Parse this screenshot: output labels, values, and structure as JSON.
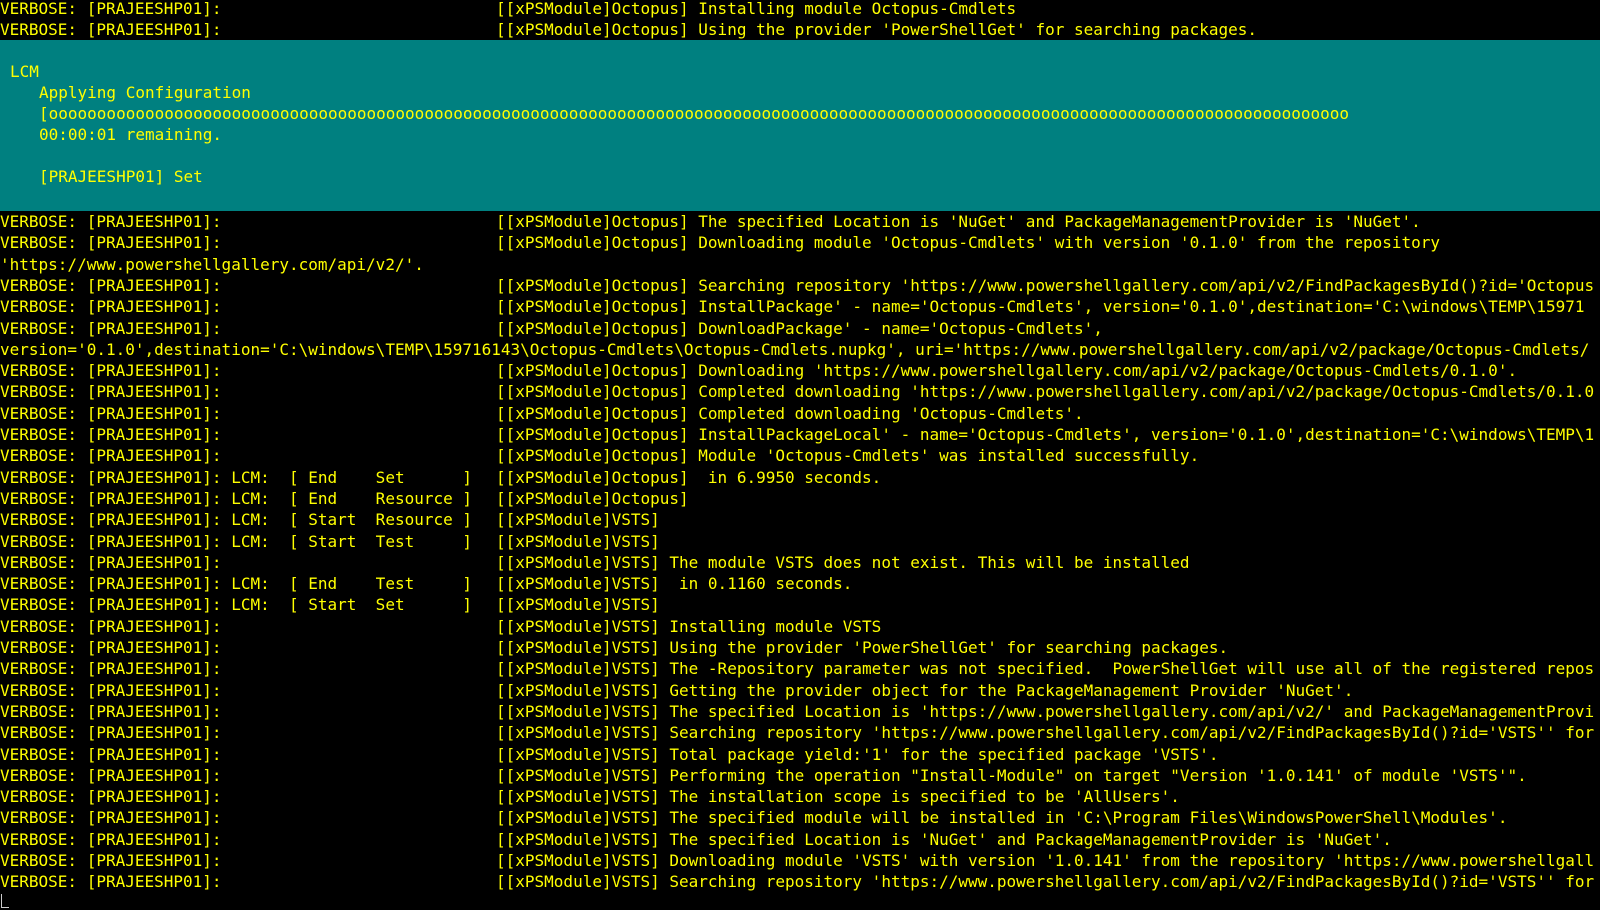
{
  "colors": {
    "background": "#000000",
    "text": "#ffff00",
    "progress_background": "#008080"
  },
  "lines_top": [
    {
      "src": "VERBOSE: [PRAJEESHP01]:",
      "msg": "[[xPSModule]Octopus] Installing module Octopus-Cmdlets"
    },
    {
      "src": "VERBOSE: [PRAJEESHP01]:",
      "msg": "[[xPSModule]Octopus] Using the provider 'PowerShellGet' for searching packages."
    }
  ],
  "progress": {
    "activity": "LCM",
    "status": "Applying Configuration",
    "bar": "[ooooooooooooooooooooooooooooooooooooooooooooooooooooooooooooooooooooooooooooooooooooooooooooooooooooooooooooooooooooooooooooooooooooooo",
    "remaining": "00:00:01 remaining.",
    "operation": "[PRAJEESHP01] Set"
  },
  "lines": [
    {
      "src": "VERBOSE: [PRAJEESHP01]:",
      "msg": "[[xPSModule]Octopus] The specified Location is 'NuGet' and PackageManagementProvider is 'NuGet'."
    },
    {
      "src": "VERBOSE: [PRAJEESHP01]:",
      "msg": "[[xPSModule]Octopus] Downloading module 'Octopus-Cmdlets' with version '0.1.0' from the repository"
    },
    {
      "src": "'https://www.powershellgallery.com/api/v2/'.",
      "msg": ""
    },
    {
      "src": "VERBOSE: [PRAJEESHP01]:",
      "msg": "[[xPSModule]Octopus] Searching repository 'https://www.powershellgallery.com/api/v2/FindPackagesById()?id='Octopus"
    },
    {
      "src": "VERBOSE: [PRAJEESHP01]:",
      "msg": "[[xPSModule]Octopus] InstallPackage' - name='Octopus-Cmdlets', version='0.1.0',destination='C:\\windows\\TEMP\\15971"
    },
    {
      "src": "VERBOSE: [PRAJEESHP01]:",
      "msg": "[[xPSModule]Octopus] DownloadPackage' - name='Octopus-Cmdlets',"
    },
    {
      "src": "version='0.1.0',destination='C:\\windows\\TEMP\\159716143\\Octopus-Cmdlets\\Octopus-Cmdlets.nupkg', uri='https://www.powershellgallery.com/api/v2/package/Octopus-Cmdlets/",
      "msg": ""
    },
    {
      "src": "VERBOSE: [PRAJEESHP01]:",
      "msg": "[[xPSModule]Octopus] Downloading 'https://www.powershellgallery.com/api/v2/package/Octopus-Cmdlets/0.1.0'."
    },
    {
      "src": "VERBOSE: [PRAJEESHP01]:",
      "msg": "[[xPSModule]Octopus] Completed downloading 'https://www.powershellgallery.com/api/v2/package/Octopus-Cmdlets/0.1.0"
    },
    {
      "src": "VERBOSE: [PRAJEESHP01]:",
      "msg": "[[xPSModule]Octopus] Completed downloading 'Octopus-Cmdlets'."
    },
    {
      "src": "VERBOSE: [PRAJEESHP01]:",
      "msg": "[[xPSModule]Octopus] InstallPackageLocal' - name='Octopus-Cmdlets', version='0.1.0',destination='C:\\windows\\TEMP\\1"
    },
    {
      "src": "VERBOSE: [PRAJEESHP01]:",
      "msg": "[[xPSModule]Octopus] Module 'Octopus-Cmdlets' was installed successfully."
    },
    {
      "src": "VERBOSE: [PRAJEESHP01]: LCM:  [ End    Set      ]",
      "msg": "[[xPSModule]Octopus]  in 6.9950 seconds."
    },
    {
      "src": "VERBOSE: [PRAJEESHP01]: LCM:  [ End    Resource ]",
      "msg": "[[xPSModule]Octopus]"
    },
    {
      "src": "VERBOSE: [PRAJEESHP01]: LCM:  [ Start  Resource ]",
      "msg": "[[xPSModule]VSTS]"
    },
    {
      "src": "VERBOSE: [PRAJEESHP01]: LCM:  [ Start  Test     ]",
      "msg": "[[xPSModule]VSTS]"
    },
    {
      "src": "VERBOSE: [PRAJEESHP01]:",
      "msg": "[[xPSModule]VSTS] The module VSTS does not exist. This will be installed"
    },
    {
      "src": "VERBOSE: [PRAJEESHP01]: LCM:  [ End    Test     ]",
      "msg": "[[xPSModule]VSTS]  in 0.1160 seconds."
    },
    {
      "src": "VERBOSE: [PRAJEESHP01]: LCM:  [ Start  Set      ]",
      "msg": "[[xPSModule]VSTS]"
    },
    {
      "src": "VERBOSE: [PRAJEESHP01]:",
      "msg": "[[xPSModule]VSTS] Installing module VSTS"
    },
    {
      "src": "VERBOSE: [PRAJEESHP01]:",
      "msg": "[[xPSModule]VSTS] Using the provider 'PowerShellGet' for searching packages."
    },
    {
      "src": "VERBOSE: [PRAJEESHP01]:",
      "msg": "[[xPSModule]VSTS] The -Repository parameter was not specified.  PowerShellGet will use all of the registered repos"
    },
    {
      "src": "VERBOSE: [PRAJEESHP01]:",
      "msg": "[[xPSModule]VSTS] Getting the provider object for the PackageManagement Provider 'NuGet'."
    },
    {
      "src": "VERBOSE: [PRAJEESHP01]:",
      "msg": "[[xPSModule]VSTS] The specified Location is 'https://www.powershellgallery.com/api/v2/' and PackageManagementProvi"
    },
    {
      "src": "VERBOSE: [PRAJEESHP01]:",
      "msg": "[[xPSModule]VSTS] Searching repository 'https://www.powershellgallery.com/api/v2/FindPackagesById()?id='VSTS'' for"
    },
    {
      "src": "VERBOSE: [PRAJEESHP01]:",
      "msg": "[[xPSModule]VSTS] Total package yield:'1' for the specified package 'VSTS'."
    },
    {
      "src": "VERBOSE: [PRAJEESHP01]:",
      "msg": "[[xPSModule]VSTS] Performing the operation \"Install-Module\" on target \"Version '1.0.141' of module 'VSTS'\"."
    },
    {
      "src": "VERBOSE: [PRAJEESHP01]:",
      "msg": "[[xPSModule]VSTS] The installation scope is specified to be 'AllUsers'."
    },
    {
      "src": "VERBOSE: [PRAJEESHP01]:",
      "msg": "[[xPSModule]VSTS] The specified module will be installed in 'C:\\Program Files\\WindowsPowerShell\\Modules'."
    },
    {
      "src": "VERBOSE: [PRAJEESHP01]:",
      "msg": "[[xPSModule]VSTS] The specified Location is 'NuGet' and PackageManagementProvider is 'NuGet'."
    },
    {
      "src": "VERBOSE: [PRAJEESHP01]:",
      "msg": "[[xPSModule]VSTS] Downloading module 'VSTS' with version '1.0.141' from the repository 'https://www.powershellgall"
    },
    {
      "src": "VERBOSE: [PRAJEESHP01]:",
      "msg": "[[xPSModule]VSTS] Searching repository 'https://www.powershellgallery.com/api/v2/FindPackagesById()?id='VSTS'' for"
    }
  ]
}
